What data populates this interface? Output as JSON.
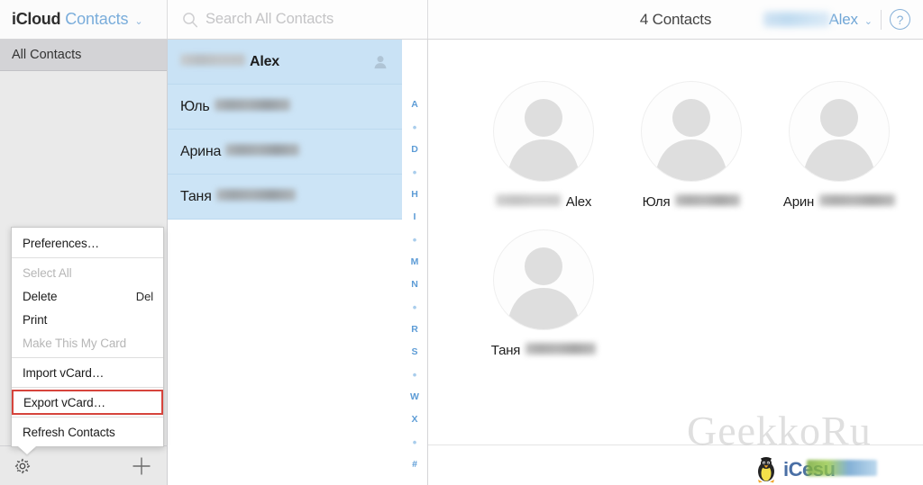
{
  "topbar": {
    "brand_primary": "iCloud",
    "brand_app": "Contacts",
    "brand_chevron": "⌄",
    "search_placeholder": "Search All Contacts",
    "search_value": "",
    "contacts_count": "4 Contacts",
    "account_name": "Alex",
    "account_chevron": "⌄",
    "help_label": "?"
  },
  "sidebar": {
    "groups": [
      {
        "label": "All Contacts",
        "selected": true
      }
    ],
    "settings_icon": "gear-icon",
    "add_icon": "plus-icon"
  },
  "contact_list": {
    "rows": [
      {
        "first_name": "",
        "display_suffix": "Alex",
        "bold": true,
        "selected": true,
        "has_person_icon": true,
        "blur_width": 72,
        "blur_light": true
      },
      {
        "first_name": "Юль",
        "display_suffix": "",
        "bold": false,
        "selected": true,
        "has_person_icon": false,
        "blur_width": 84,
        "blur_light": false
      },
      {
        "first_name": "Арина",
        "display_suffix": "",
        "bold": false,
        "selected": true,
        "has_person_icon": false,
        "blur_width": 82,
        "blur_light": false
      },
      {
        "first_name": "Таня",
        "display_suffix": "",
        "bold": false,
        "selected": true,
        "has_person_icon": false,
        "blur_width": 88,
        "blur_light": false
      }
    ],
    "alpha_index": [
      "A",
      "•",
      "D",
      "•",
      "H",
      "I",
      "•",
      "M",
      "N",
      "•",
      "R",
      "S",
      "•",
      "W",
      "X",
      "•",
      "#"
    ]
  },
  "main": {
    "cards": [
      {
        "name_visible": "Alex",
        "name_prefix_blurred": true,
        "prefix_blur_width": 72,
        "suffix_blur_width": 0
      },
      {
        "name_visible": "Юля",
        "name_prefix_blurred": false,
        "prefix_blur_width": 0,
        "suffix_blur_width": 72
      },
      {
        "name_visible": "Арин",
        "name_prefix_blurred": false,
        "prefix_blur_width": 0,
        "suffix_blur_width": 84
      },
      {
        "name_visible": "Таня",
        "name_prefix_blurred": false,
        "prefix_blur_width": 0,
        "suffix_blur_width": 78
      }
    ]
  },
  "context_menu": {
    "items": [
      {
        "label": "Preferences…",
        "shortcut": "",
        "disabled": false,
        "highlighted": false,
        "divider_after": true
      },
      {
        "label": "Select All",
        "shortcut": "",
        "disabled": true,
        "highlighted": false,
        "divider_after": false
      },
      {
        "label": "Delete",
        "shortcut": "Del",
        "disabled": false,
        "highlighted": false,
        "divider_after": false
      },
      {
        "label": "Print",
        "shortcut": "",
        "disabled": false,
        "highlighted": false,
        "divider_after": false
      },
      {
        "label": "Make This My Card",
        "shortcut": "",
        "disabled": true,
        "highlighted": false,
        "divider_after": true
      },
      {
        "label": "Import vCard…",
        "shortcut": "",
        "disabled": false,
        "highlighted": false,
        "divider_after": true
      },
      {
        "label": "Export vCard…",
        "shortcut": "",
        "disabled": false,
        "highlighted": true,
        "divider_after": true
      },
      {
        "label": "Refresh Contacts",
        "shortcut": "",
        "disabled": false,
        "highlighted": false,
        "divider_after": false
      }
    ],
    "highlight_color": "#d6443c"
  },
  "watermarks": {
    "primary": "GeekkoRu",
    "secondary": "ice.......su",
    "secondary_prefix": "iCe",
    "secondary_suffix": "su"
  },
  "colors": {
    "selection_blue": "#cce4f6",
    "brand_blue": "#7aaddb",
    "index_blue": "#5d9cd6",
    "sidebar_grey": "#eaeaea",
    "highlight_red": "#d6443c"
  }
}
